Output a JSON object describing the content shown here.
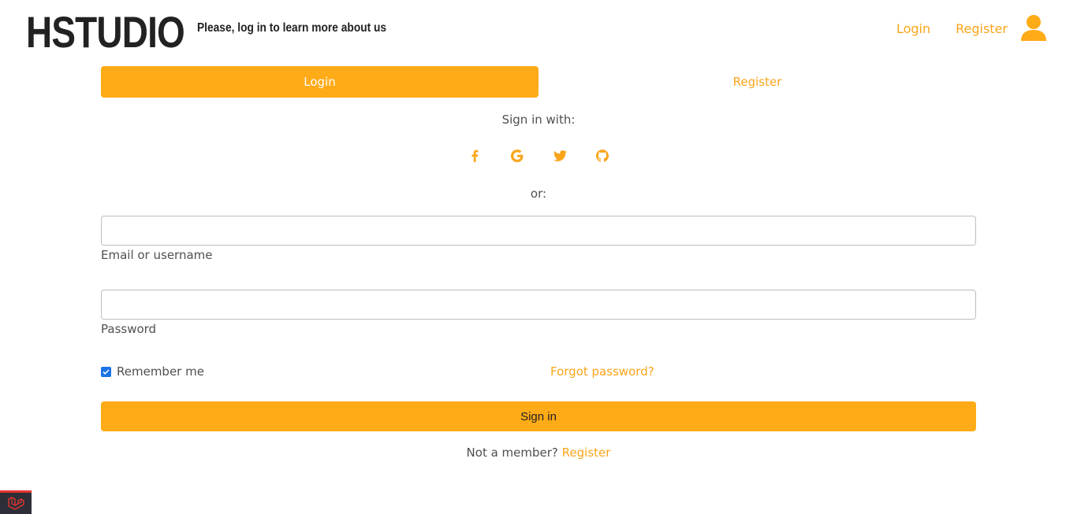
{
  "header": {
    "brand": "HSTUDIO",
    "tagline": "Please, log in to learn more about us",
    "nav": {
      "login": "Login",
      "register": "Register"
    }
  },
  "tabs": [
    {
      "label": "Login",
      "active": true
    },
    {
      "label": "Register",
      "active": false
    }
  ],
  "social": {
    "heading": "Sign in with:",
    "icons": [
      "facebook-icon",
      "google-icon",
      "twitter-icon",
      "github-icon"
    ],
    "or": "or:"
  },
  "form": {
    "email_label": "Email or username",
    "email_value": "",
    "password_label": "Password",
    "password_value": "",
    "remember_label": "Remember me",
    "remember_checked": true,
    "forgot": "Forgot password?",
    "submit": "Sign in",
    "not_member": "Not a member?",
    "register_link": "Register"
  },
  "colors": {
    "accent": "#ffab17",
    "link": "#f9a51a",
    "text": "#4f4f4f",
    "brand": "#222222",
    "checkbox": "#1a73e8"
  }
}
